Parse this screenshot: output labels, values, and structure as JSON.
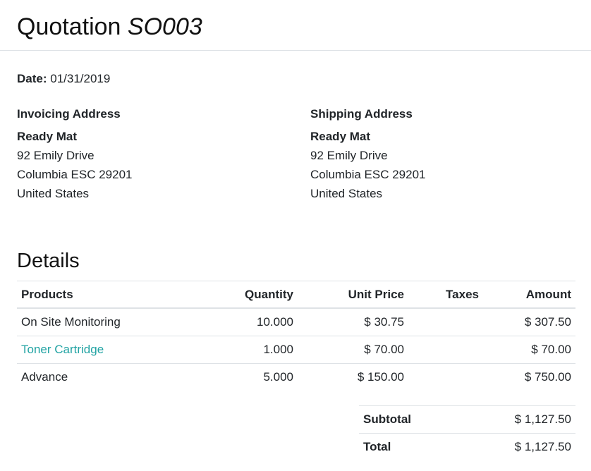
{
  "header": {
    "title_prefix": "Quotation",
    "number": "SO003"
  },
  "date": {
    "label": "Date:",
    "value": "01/31/2019"
  },
  "invoicing_address": {
    "heading": "Invoicing Address",
    "name": "Ready Mat",
    "street": "92 Emily Drive",
    "city_line": "Columbia ESC 29201",
    "country": "United States"
  },
  "shipping_address": {
    "heading": "Shipping Address",
    "name": "Ready Mat",
    "street": "92 Emily Drive",
    "city_line": "Columbia ESC 29201",
    "country": "United States"
  },
  "details": {
    "title": "Details",
    "columns": {
      "products": "Products",
      "quantity": "Quantity",
      "unit_price": "Unit Price",
      "taxes": "Taxes",
      "amount": "Amount"
    },
    "lines": [
      {
        "product": "On Site Monitoring",
        "quantity": "10.000",
        "unit_price": "$ 30.75",
        "taxes": "",
        "amount": "$ 307.50"
      },
      {
        "product": "Toner Cartridge",
        "quantity": "1.000",
        "unit_price": "$ 70.00",
        "taxes": "",
        "amount": "$ 70.00"
      },
      {
        "product": "Advance",
        "quantity": "5.000",
        "unit_price": "$ 150.00",
        "taxes": "",
        "amount": "$ 750.00"
      }
    ]
  },
  "totals": {
    "subtotal_label": "Subtotal",
    "subtotal_value": "$ 1,127.50",
    "total_label": "Total",
    "total_value": "$ 1,127.50"
  },
  "colors": {
    "link": "#21a3a3",
    "border": "#dee2e6"
  }
}
